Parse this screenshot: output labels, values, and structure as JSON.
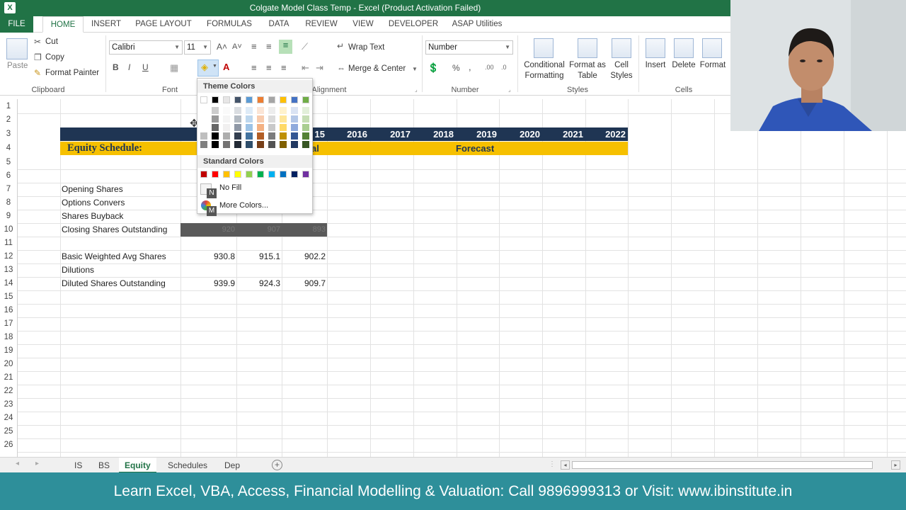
{
  "window": {
    "title": "Colgate Model Class Temp - Excel (Product Activation Failed)",
    "app_icon": "X"
  },
  "menu": {
    "tabs": [
      "FILE",
      "HOME",
      "INSERT",
      "PAGE LAYOUT",
      "FORMULAS",
      "DATA",
      "REVIEW",
      "VIEW",
      "DEVELOPER",
      "ASAP Utilities"
    ],
    "active": "HOME"
  },
  "ribbon": {
    "clipboard": {
      "paste": "Paste",
      "cut": "Cut",
      "copy": "Copy",
      "format_painter": "Format Painter",
      "label": "Clipboard"
    },
    "font": {
      "name": "Calibri",
      "size": "11",
      "label": "Font",
      "bold": "B",
      "italic": "I",
      "underline": "U"
    },
    "alignment": {
      "wrap_text": "Wrap Text",
      "merge_center": "Merge & Center",
      "label": "Alignment"
    },
    "number": {
      "format": "Number",
      "label": "Number",
      "percent": "%",
      "comma": ","
    },
    "styles": {
      "conditional_1": "Conditional",
      "conditional_2": "Formatting",
      "format_table_1": "Format as",
      "format_table_2": "Table",
      "cell_styles_1": "Cell",
      "cell_styles_2": "Styles",
      "label": "Styles"
    },
    "cells": {
      "insert": "Insert",
      "delete": "Delete",
      "format": "Format",
      "label": "Cells"
    }
  },
  "fill_popup": {
    "theme_title": "Theme Colors",
    "standard_title": "Standard Colors",
    "no_fill": "No Fill",
    "no_fill_key": "N",
    "more_colors": "More Colors...",
    "more_colors_key": "M",
    "theme_top": [
      "#ffffff",
      "#000000",
      "#e7e6e6",
      "#44546a",
      "#5b9bd5",
      "#ed7d31",
      "#a5a5a5",
      "#ffc000",
      "#4472c4",
      "#70ad47"
    ],
    "standard": [
      "#c00000",
      "#ff0000",
      "#ffc000",
      "#ffff00",
      "#92d050",
      "#00b050",
      "#00b0f0",
      "#0070c0",
      "#002060",
      "#7030a0"
    ]
  },
  "sheet": {
    "rows": [
      "1",
      "2",
      "3",
      "4",
      "5",
      "6",
      "7",
      "8",
      "9",
      "10",
      "11",
      "12",
      "13",
      "14",
      "15",
      "16",
      "17",
      "18",
      "19",
      "20",
      "21",
      "22",
      "23",
      "24",
      "25",
      "26"
    ],
    "header_years": [
      "15",
      "2016",
      "2017",
      "2018",
      "2019",
      "2020",
      "2021",
      "2022"
    ],
    "equity_schedule": "Equity Schedule:",
    "actual_tail": "al",
    "forecast": "Forecast",
    "labels": {
      "opening": "Opening Shares",
      "options": "Options Convers",
      "buyback": "Shares Buyback",
      "closing": "Closing Shares Outstanding",
      "basic": "Basic Weighted Avg Shares",
      "dilutions": "Dilutions",
      "diluted": "Diluted Shares Outstanding"
    },
    "closing_values": [
      "920",
      "907",
      "893"
    ],
    "basic_values": [
      "930.8",
      "915.1",
      "902.2"
    ],
    "diluted_values": [
      "939.9",
      "924.3",
      "909.7"
    ]
  },
  "sheet_tabs": [
    "IS",
    "BS",
    "Equity",
    "Schedules",
    "Dep"
  ],
  "active_sheet": "Equity",
  "banner": "Learn Excel, VBA, Access, Financial Modelling & Valuation:  Call 9896999313 or Visit: www.ibinstitute.in"
}
